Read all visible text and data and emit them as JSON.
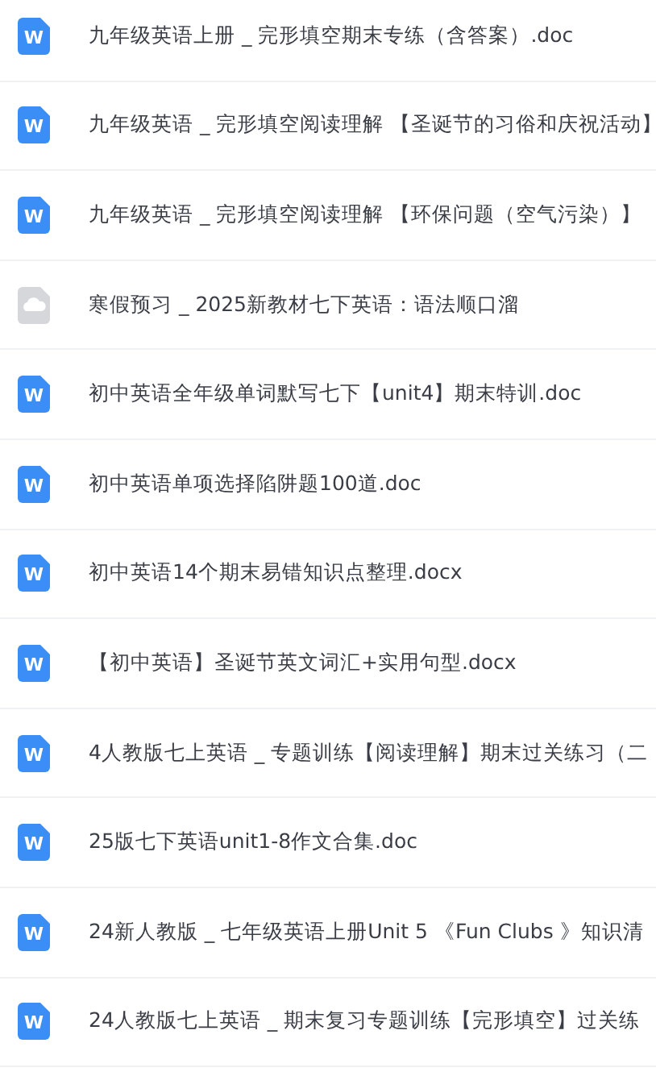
{
  "files": [
    {
      "kind": "doc",
      "icon_letter": "W",
      "name": "九年级英语上册 _ 完形填空期末专练（含答案）.doc"
    },
    {
      "kind": "doc",
      "icon_letter": "W",
      "name": "九年级英语 _ 完形填空阅读理解 【圣诞节的习俗和庆祝活动】"
    },
    {
      "kind": "doc",
      "icon_letter": "W",
      "name": "九年级英语 _ 完形填空阅读理解 【环保问题（空气污染）】"
    },
    {
      "kind": "cloud",
      "name": "寒假预习 _ 2025新教材七下英语：语法顺口溜"
    },
    {
      "kind": "doc",
      "icon_letter": "W",
      "name": "初中英语全年级单词默写七下【unit4】期末特训.doc"
    },
    {
      "kind": "doc",
      "icon_letter": "W",
      "name": "初中英语单项选择陷阱题100道.doc"
    },
    {
      "kind": "doc",
      "icon_letter": "W",
      "name": "初中英语14个期末易错知识点整理.docx"
    },
    {
      "kind": "doc",
      "icon_letter": "W",
      "name": "【初中英语】圣诞节英文词汇+实用句型.docx"
    },
    {
      "kind": "doc",
      "icon_letter": "W",
      "name": "4人教版七上英语 _ 专题训练【阅读理解】期末过关练习（二"
    },
    {
      "kind": "doc",
      "icon_letter": "W",
      "name": "25版七下英语unit1-8作文合集.doc"
    },
    {
      "kind": "doc",
      "icon_letter": "W",
      "name": "24新人教版 _ 七年级英语上册Unit 5 《Fun Clubs 》知识清"
    },
    {
      "kind": "doc",
      "icon_letter": "W",
      "name": "24人教版七上英语 _ 期末复习专题训练【完形填空】过关练"
    }
  ]
}
